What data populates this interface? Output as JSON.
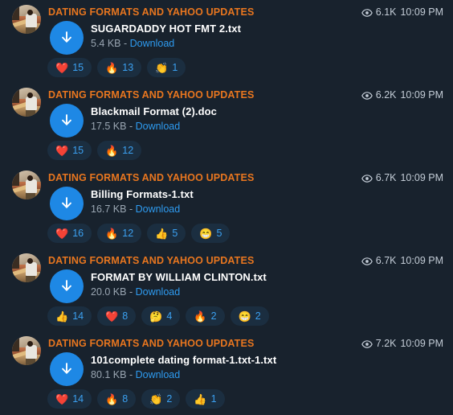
{
  "app": {
    "background_color": "#18222d",
    "channel_color": "#e8761f",
    "link_color": "#2e9bf0",
    "reaction_pill_color": "#1b2e40",
    "reaction_count_color": "#3ba0f0",
    "download_circle_color": "#1e88e5"
  },
  "icons": {
    "views": "eye-icon",
    "download": "download-arrow-icon"
  },
  "labels": {
    "download": "Download",
    "separator": "-"
  },
  "messages": [
    {
      "channel": "DATING FORMATS AND YAHOO UPDATES",
      "views": "6.1K",
      "time": "10:09 PM",
      "filename": "SUGARDADDY HOT FMT 2.txt",
      "filesize": "5.4 KB",
      "download": "Download",
      "reactions": [
        {
          "emoji": "❤️",
          "name": "heart",
          "count": "15"
        },
        {
          "emoji": "🔥",
          "name": "fire",
          "count": "13"
        },
        {
          "emoji": "👏",
          "name": "clap",
          "count": "1"
        }
      ]
    },
    {
      "channel": "DATING FORMATS AND YAHOO UPDATES",
      "views": "6.2K",
      "time": "10:09 PM",
      "filename": "Blackmail Format (2).doc",
      "filesize": "17.5 KB",
      "download": "Download",
      "reactions": [
        {
          "emoji": "❤️",
          "name": "heart",
          "count": "15"
        },
        {
          "emoji": "🔥",
          "name": "fire",
          "count": "12"
        }
      ]
    },
    {
      "channel": "DATING FORMATS AND YAHOO UPDATES",
      "views": "6.7K",
      "time": "10:09 PM",
      "filename": "Billing Formats-1.txt",
      "filesize": "16.7 KB",
      "download": "Download",
      "reactions": [
        {
          "emoji": "❤️",
          "name": "heart",
          "count": "16"
        },
        {
          "emoji": "🔥",
          "name": "fire",
          "count": "12"
        },
        {
          "emoji": "👍",
          "name": "thumbs-up",
          "count": "5"
        },
        {
          "emoji": "😁",
          "name": "grin",
          "count": "5"
        }
      ]
    },
    {
      "channel": "DATING FORMATS AND YAHOO UPDATES",
      "views": "6.7K",
      "time": "10:09 PM",
      "filename": "FORMAT BY WILLIAM CLINTON.txt",
      "filesize": "20.0 KB",
      "download": "Download",
      "reactions": [
        {
          "emoji": "👍",
          "name": "thumbs-up",
          "count": "14"
        },
        {
          "emoji": "❤️",
          "name": "heart",
          "count": "8"
        },
        {
          "emoji": "🤔",
          "name": "thinking",
          "count": "4"
        },
        {
          "emoji": "🔥",
          "name": "fire",
          "count": "2"
        },
        {
          "emoji": "😁",
          "name": "grin",
          "count": "2"
        }
      ]
    },
    {
      "channel": "DATING FORMATS AND YAHOO UPDATES",
      "views": "7.2K",
      "time": "10:09 PM",
      "filename": "101complete dating format-1.txt-1.txt",
      "filesize": "80.1 KB",
      "download": "Download",
      "reactions": [
        {
          "emoji": "❤️",
          "name": "heart",
          "count": "14"
        },
        {
          "emoji": "🔥",
          "name": "fire",
          "count": "8"
        },
        {
          "emoji": "👏",
          "name": "clap",
          "count": "2"
        },
        {
          "emoji": "👍",
          "name": "thumbs-up",
          "count": "1"
        }
      ]
    }
  ]
}
